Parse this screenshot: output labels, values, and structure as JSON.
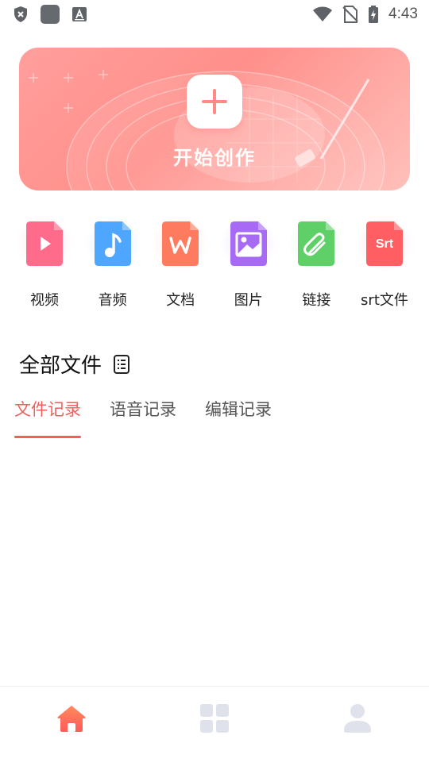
{
  "status_bar": {
    "time": "4:43",
    "icons": [
      "shield-x-icon",
      "square-app-icon",
      "a-text-icon",
      "wifi-icon",
      "no-sim-icon",
      "battery-charging-icon"
    ]
  },
  "hero": {
    "create_label": "开始创作",
    "icon": "plus-icon",
    "colors": {
      "start": "#ff9f9c",
      "end": "#ffc0bb"
    }
  },
  "categories": [
    {
      "label": "视频",
      "icon": "video-file-icon",
      "color": "#ff6b8a"
    },
    {
      "label": "音频",
      "icon": "audio-file-icon",
      "color": "#4fa6ff"
    },
    {
      "label": "文档",
      "icon": "document-file-icon",
      "color": "#ff7b5f"
    },
    {
      "label": "图片",
      "icon": "image-file-icon",
      "color": "#a76af5"
    },
    {
      "label": "链接",
      "icon": "link-file-icon",
      "color": "#5fd067"
    },
    {
      "label": "srt文件",
      "icon": "srt-file-icon",
      "color": "#ff5f63",
      "badge": "Srt"
    }
  ],
  "all_files": {
    "title": "全部文件",
    "icon": "list-document-icon"
  },
  "tabs": [
    {
      "label": "文件记录",
      "active": true
    },
    {
      "label": "语音记录",
      "active": false
    },
    {
      "label": "编辑记录",
      "active": false
    }
  ],
  "bottom_nav": [
    {
      "name": "home",
      "icon": "home-icon",
      "active": true,
      "color": "#ff6b5a"
    },
    {
      "name": "apps",
      "icon": "grid-icon",
      "active": false,
      "color": "#dfe2ea"
    },
    {
      "name": "profile",
      "icon": "user-icon",
      "active": false,
      "color": "#dfe2ea"
    }
  ]
}
